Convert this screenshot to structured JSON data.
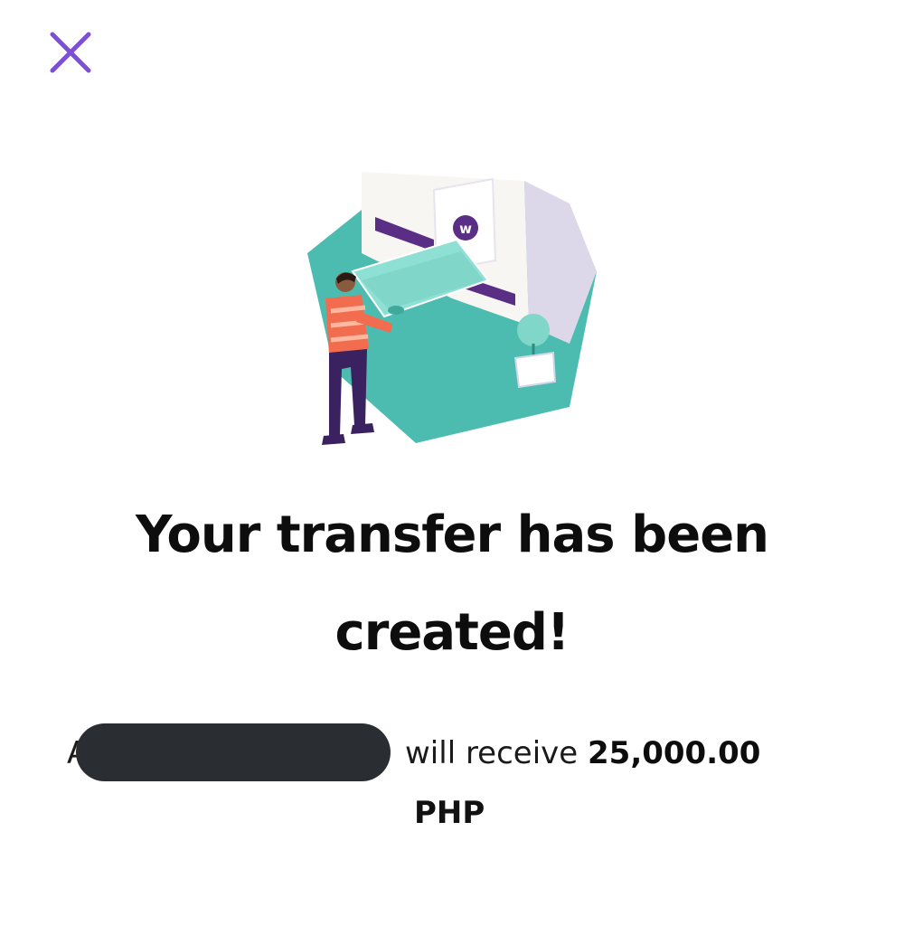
{
  "header": {
    "close_icon": "close-icon",
    "accent_color": "#7b4fd6"
  },
  "illustration": {
    "logo_letter": "w",
    "description_icon": "atm-transfer-illustration"
  },
  "confirmation": {
    "title": "Your transfer has been created!",
    "recipient_initial": "A",
    "recipient_redacted": true,
    "receive_text": "will receive",
    "amount": "25,000.00",
    "currency": "PHP"
  },
  "colors": {
    "teal": "#4dbcb0",
    "purple": "#5a2e85",
    "orange": "#f26c4f",
    "redaction": "#2a2d31"
  }
}
